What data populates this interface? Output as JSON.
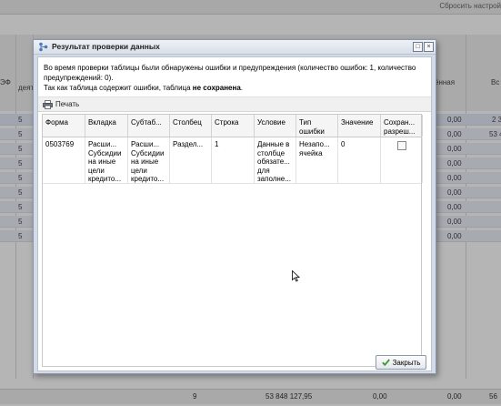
{
  "background": {
    "reset_label": "Сбросить настрой",
    "header_cells": [
      "ЭФ",
      "деят",
      "ённая",
      "Вс"
    ],
    "row_codes": [
      "5",
      "5",
      "5",
      "5",
      "5",
      "5",
      "5",
      "5",
      "5"
    ],
    "right_values": [
      {
        "a": "0,00",
        "b": "2 3"
      },
      {
        "a": "0,00",
        "b": "53 4"
      },
      {
        "a": "0,00",
        "b": ""
      },
      {
        "a": "0,00",
        "b": ""
      },
      {
        "a": "0,00",
        "b": ""
      },
      {
        "a": "0,00",
        "b": ""
      },
      {
        "a": "0,00",
        "b": ""
      },
      {
        "a": "0,00",
        "b": ""
      },
      {
        "a": "0,00",
        "b": ""
      }
    ],
    "footer": {
      "count": "9",
      "sum": "53 848 127,95",
      "v1": "0,00",
      "v2": "0,00",
      "v3": "56"
    }
  },
  "dialog": {
    "title": "Результат проверки данных",
    "message_line1": "Во время проверки таблицы были обнаружены ошибки и предупреждения (количество ошибок: 1, количество предупреждений: 0).",
    "message_line2_prefix": "Так как таблица содержит ошибки, таблица ",
    "message_line2_bold": "не сохранена",
    "message_line2_suffix": ".",
    "print_label": "Печать",
    "columns": [
      "Форма",
      "Вкладка",
      "Субтаб...",
      "Столбец",
      "Строка",
      "Условие",
      "Тип ошибки",
      "Значение",
      "Сохран... разреш..."
    ],
    "rows": [
      {
        "form": "0503769",
        "tab": "Расши... Субсидии на иные цели кредито...",
        "subtab": "Расши... Субсидии на иные цели кредито...",
        "column": "Раздел...",
        "row": "1",
        "condition": "Данные в столбце обязате... для заполне...",
        "error_type": "Незапо... ячейка",
        "value": "0"
      }
    ],
    "close_label": "Закрыть"
  },
  "colors": {
    "accent": "#3a9a2e",
    "dialog_bg": "#d4dbe6"
  }
}
